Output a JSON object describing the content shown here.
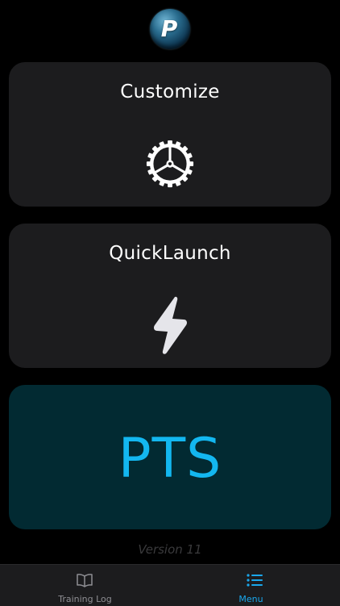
{
  "header": {
    "logo_letter": "P"
  },
  "cards": {
    "customize": {
      "title": "Customize",
      "icon": "gear-icon"
    },
    "quicklaunch": {
      "title": "QuickLaunch",
      "icon": "lightning-bolt-icon"
    },
    "pts": {
      "label": "PTS"
    }
  },
  "footer": {
    "version": "Version 11"
  },
  "tab_bar": {
    "tabs": [
      {
        "label": "Training Log",
        "icon": "open-book-icon",
        "active": false
      },
      {
        "label": "Menu",
        "icon": "list-icon",
        "active": true
      }
    ]
  },
  "colors": {
    "background": "#000000",
    "card": "#1c1c1e",
    "pts_card": "#022a32",
    "accent": "#13b7f0",
    "tab_active": "#1aa7ec",
    "tab_inactive": "#8e8e93"
  }
}
